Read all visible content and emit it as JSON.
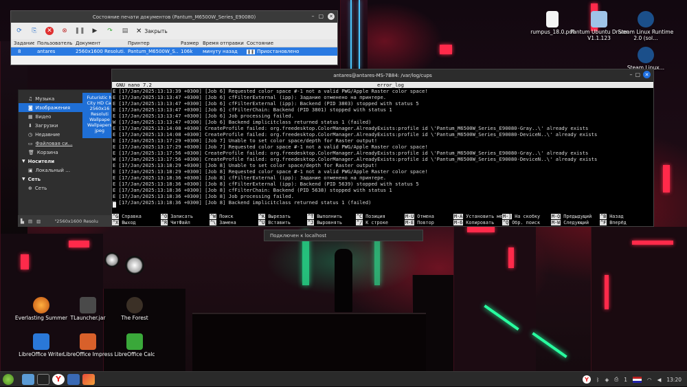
{
  "desktop_icons": [
    {
      "label": "Everlasting Summer",
      "icon": "everlasting-summer-icon"
    },
    {
      "label": "TLauncher.jar",
      "icon": "game-controller-icon"
    },
    {
      "label": "The Forest",
      "icon": "forest-icon"
    },
    {
      "label": "LibreOffice Writer",
      "icon": "writer-icon"
    },
    {
      "label": "LibreOffice Impress",
      "icon": "impress-icon"
    },
    {
      "label": "LibreOffice Calc",
      "icon": "calc-icon"
    },
    {
      "label": "rumpus_18.0.pdf",
      "icon": "pdf-icon"
    },
    {
      "label": "Pantum Ubuntu Driver V1.1.123",
      "icon": "folder-icon"
    },
    {
      "label": "Steam Linux Runtime 2.0 (sol…",
      "icon": "steam-icon"
    },
    {
      "label": "Steam Linux…",
      "icon": "steam-icon"
    }
  ],
  "print_window": {
    "title": "Состояние печати документов (Pantum_M6500W_Series_E90080)",
    "close_label": "Закрыть",
    "columns": [
      "Задание",
      "Пользователь",
      "Документ",
      "Принтер",
      "Размер",
      "Время отправки",
      "Состояние"
    ],
    "row": [
      "8",
      "antares",
      "2560x1600 Resoluti…",
      "Pantum_M6500W_S…",
      "106k",
      "минуту назад",
      "Приостановлено"
    ]
  },
  "file_manager": {
    "places": [
      "Музыка",
      "Изображения",
      "Видео",
      "Загрузки",
      "Недавние",
      "Файловая си…",
      "Корзина"
    ],
    "devices_header": "Носители",
    "devices": [
      "Локальный …"
    ],
    "network_header": "Сеть",
    "network": [
      "Сеть"
    ],
    "selected_file": "Futuristic N City HD Cal 2560x16 Resoluti Wallpape Wallpapers jpeg",
    "status": "\"2560x1600 Resolu"
  },
  "terminal": {
    "title": "antares@antares-MS-7B84: /var/log/cups",
    "nano_version": "GNU nano 7.2",
    "file_name": "error_log",
    "lines": [
      "E [17/Jan/2025:13:13:39 +0300] [Job 6] Requested color space #-1 not a valid PWG/Apple Raster color space!",
      "E [17/Jan/2025:13:13:47 +0300] [Job 6] cfFilterExternal (ipp): Задание отменено на принтере.",
      "E [17/Jan/2025:13:13:47 +0300] [Job 6] cfFilterExternal (ipp): Backend (PID 3803) stopped with status 5",
      "E [17/Jan/2025:13:13:47 +0300] [Job 6] cfFilterChain: Backend (PID 3801) stopped with status 1",
      "E [17/Jan/2025:13:13:47 +0300] [Job 6] Job processing failed.",
      "W [17/Jan/2025:13:13:47 +0300] [Job 6] Backend implicitclass returned status 1 (failed)",
      "E [17/Jan/2025:13:14:08 +0300] CreateProfile failed: org.freedesktop.ColorManager.AlreadyExists:profile id \\'Pantum_M6500W_Series_E90080-Gray..\\' already exists",
      "E [17/Jan/2025:13:14:08 +0300] CreateProfile failed: org.freedesktop.ColorManager.AlreadyExists:profile id \\'Pantum_M6500W_Series_E90080-DeviceN..\\' already exists",
      "E [17/Jan/2025:13:17:29 +0300] [Job 7] Unable to set color space/depth for Raster output!",
      "E [17/Jan/2025:13:17:29 +0300] [Job 7] Requested color space #-1 not a valid PWG/Apple Raster color space!",
      "E [17/Jan/2025:13:17:56 +0300] CreateProfile failed: org.freedesktop.ColorManager.AlreadyExists:profile id \\'Pantum_M6500W_Series_E90080-Gray..\\' already exists",
      "W [17/Jan/2025:13:17:56 +0300] CreateProfile failed: org.freedesktop.ColorManager.AlreadyExists:profile id \\'Pantum_M6500W_Series_E90080-DeviceN..\\' already exists",
      "E [17/Jan/2025:13:18:29 +0300] [Job 8] Unable to set color space/depth for Raster output!",
      "E [17/Jan/2025:13:18:29 +0300] [Job 8] Requested color space #-1 not a valid PWG/Apple Raster color space!",
      "E [17/Jan/2025:13:18:36 +0300] [Job 8] cfFilterExternal (ipp): Задание отменено на принтере.",
      "E [17/Jan/2025:13:18:36 +0300] [Job 8] cfFilterExternal (ipp): Backend (PID 5639) stopped with status 5",
      "E [17/Jan/2025:13:18:36 +0300] [Job 8] cfFilterChain: Backend (PID 5638) stopped with status 1",
      "E [17/Jan/2025:13:18:36 +0300] [Job 8] Job processing failed.",
      "W [17/Jan/2025:13:18:36 +0300] [Job 8] Backend implicitclass returned status 1 (failed)"
    ],
    "shortcuts": [
      {
        "key": "^G",
        "label": "Справка"
      },
      {
        "key": "^X",
        "label": "Выход"
      },
      {
        "key": "^O",
        "label": "Записать"
      },
      {
        "key": "^R",
        "label": "ЧитФайл"
      },
      {
        "key": "^W",
        "label": "Поиск"
      },
      {
        "key": "^\\",
        "label": "Замена"
      },
      {
        "key": "^K",
        "label": "Вырезать"
      },
      {
        "key": "^U",
        "label": "Вставить"
      },
      {
        "key": "^T",
        "label": "Выполнить"
      },
      {
        "key": "^J",
        "label": "Выровнять"
      },
      {
        "key": "^C",
        "label": "Позиция"
      },
      {
        "key": "^/",
        "label": "К строке"
      },
      {
        "key": "M-U",
        "label": "Отмена"
      },
      {
        "key": "M-E",
        "label": "Повтор"
      },
      {
        "key": "M-A",
        "label": "Установить ме"
      },
      {
        "key": "M-6",
        "label": "Копировать"
      },
      {
        "key": "M-]",
        "label": "На скобку"
      },
      {
        "key": "^Q",
        "label": "Обр. поиск"
      },
      {
        "key": "M-Q",
        "label": "Предыдущий"
      },
      {
        "key": "M-W",
        "label": "Следующий"
      },
      {
        "key": "^B",
        "label": "Назад"
      },
      {
        "key": "^F",
        "label": "Вперёд"
      }
    ]
  },
  "tooltip": "Подключен к localhost",
  "tray": {
    "time": "13:20",
    "printer_count": "1"
  }
}
